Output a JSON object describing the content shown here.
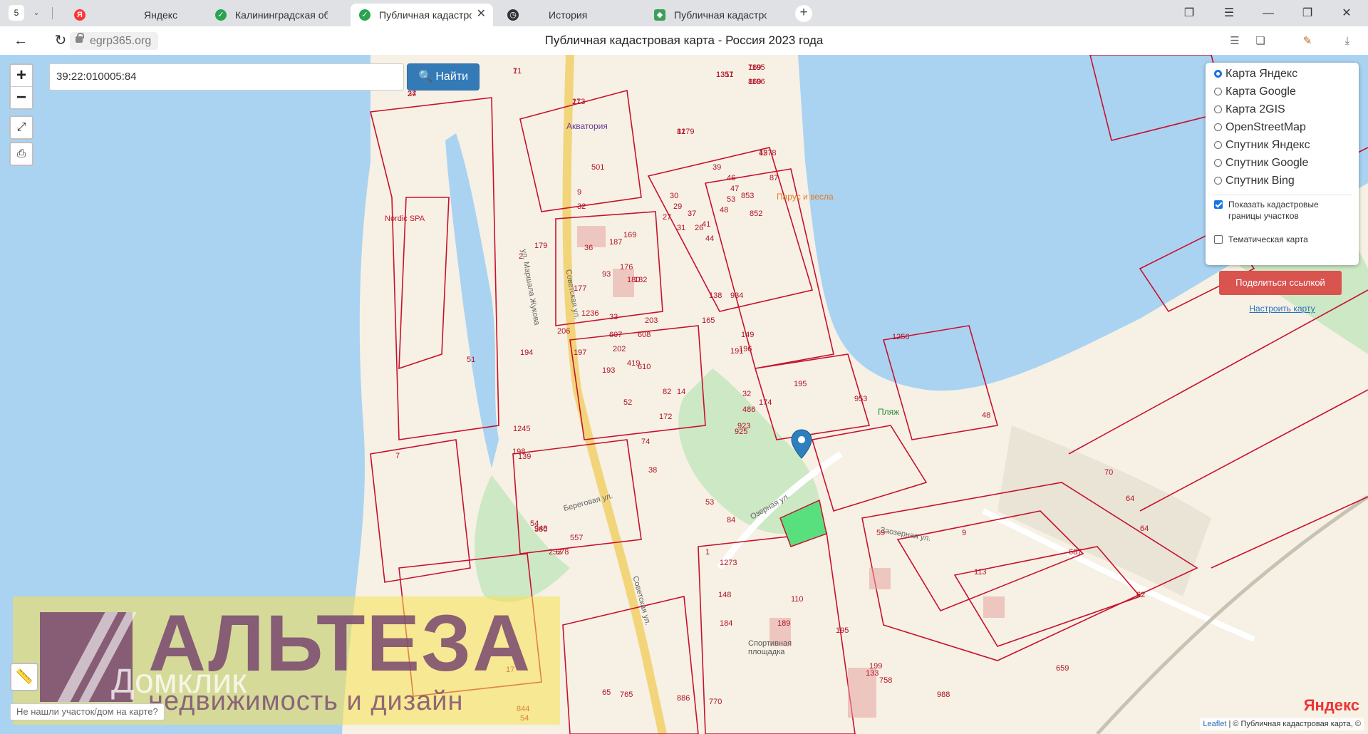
{
  "browser": {
    "tab_count": "5",
    "tabs": [
      {
        "title": "Яндекс",
        "icon": "yandex-icon"
      },
      {
        "title": "Калининградская область",
        "icon": "check-icon"
      },
      {
        "title": "Публичная кадастровая карта",
        "icon": "check-icon"
      },
      {
        "title": "История",
        "icon": "clock-icon"
      },
      {
        "title": "Публичная кадастровая к",
        "icon": "map-favicon-icon"
      }
    ],
    "url": "egrp365.org",
    "page_title": "Публичная кадастровая карта - Россия 2023 года"
  },
  "map": {
    "search": {
      "value": "39:22:010005:84",
      "button": "Найти"
    },
    "layers": [
      {
        "label": "Карта Яндекс",
        "selected": true
      },
      {
        "label": "Карта Google",
        "selected": false
      },
      {
        "label": "Карта 2GIS",
        "selected": false
      },
      {
        "label": "OpenStreetMap",
        "selected": false
      },
      {
        "label": "Спутник Яндекс",
        "selected": false
      },
      {
        "label": "Спутник Google",
        "selected": false
      },
      {
        "label": "Спутник Bing",
        "selected": false
      }
    ],
    "checkboxes": [
      {
        "label": "Показать кадастровые границы участков",
        "checked": true
      },
      {
        "label": "Тематическая карта",
        "checked": false
      }
    ],
    "share_button": "Поделиться ссылкой",
    "configure_link": "Настроить карту",
    "not_found": "Не нашли участок/дом на карте?",
    "attribution_leaflet": "Leaflet",
    "attribution_rest": "| © Публичная кадастровая карта, ©",
    "provider_logo": "Яндекс",
    "watermark": {
      "brand": "АЛЬТЕЗА",
      "tagline": "недвижимость и дизайн",
      "overlay": "Домклик"
    },
    "place_labels": [
      "Акватория",
      "Nordic SPA",
      "Парус и весла",
      "Пляж",
      "Спортивная площадка",
      "Советская ул.",
      "Озерная ул.",
      "Заозерная ул.",
      "Береговая ул.",
      "Советская ул.",
      "ул. Маршала Жукова"
    ],
    "parcel_numbers": [
      "1195",
      "1196",
      "1317",
      "1279",
      "34",
      "21",
      "1",
      "1278",
      "87",
      "501",
      "39",
      "46",
      "47",
      "53",
      "48",
      "30",
      "29",
      "27",
      "31",
      "37",
      "26",
      "41",
      "44",
      "853",
      "852",
      "9",
      "32",
      "36",
      "187",
      "169",
      "2",
      "93",
      "179",
      "176",
      "180",
      "182",
      "177",
      "165",
      "1236",
      "33",
      "203",
      "138",
      "206",
      "607",
      "608",
      "934",
      "149",
      "202",
      "197",
      "193",
      "419",
      "610",
      "191",
      "196",
      "195",
      "194",
      "51",
      "52",
      "82",
      "14",
      "32",
      "486",
      "174",
      "172",
      "923",
      "925",
      "1245",
      "198",
      "139",
      "7",
      "74",
      "38",
      "953",
      "1256",
      "48",
      "53",
      "84",
      "1",
      "1273",
      "9",
      "59",
      "70",
      "64",
      "64",
      "113",
      "148",
      "110",
      "184",
      "189",
      "195",
      "199",
      "133",
      "758",
      "62",
      "988",
      "659",
      "17",
      "844",
      "65",
      "765",
      "886",
      "770",
      "54",
      "687",
      "54",
      "380",
      "948",
      "557",
      "253",
      "678",
      "769",
      "860",
      "1351",
      "81",
      "27",
      "173",
      "71",
      "45"
    ]
  }
}
